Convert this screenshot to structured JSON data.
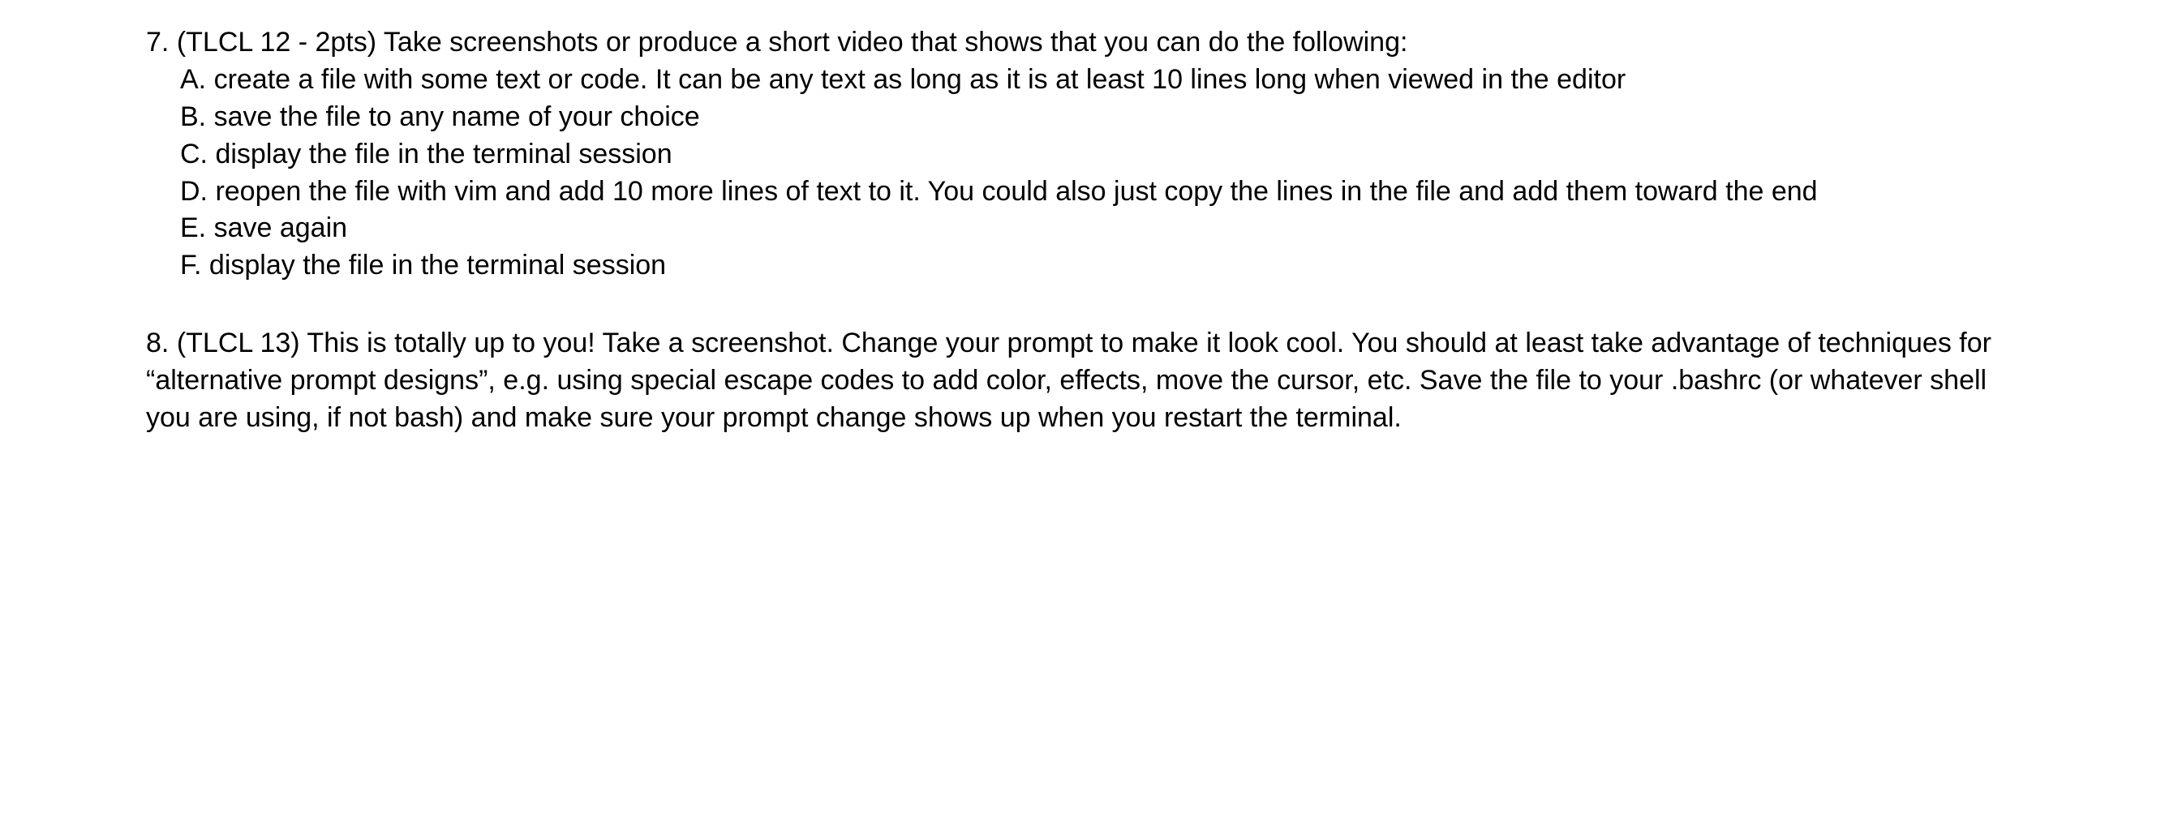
{
  "questions": [
    {
      "number": "7.",
      "intro": "(TLCL 12 - 2pts) Take screenshots or produce a short video that shows that you can do the following:",
      "subitems": [
        {
          "label": "A.",
          "text": "create a file with some text or code. It can be any text as long as it is at least 10 lines long when viewed in the editor"
        },
        {
          "label": "B.",
          "text": "save the file to any name of your choice"
        },
        {
          "label": "C.",
          "text": "display the file in the terminal session"
        },
        {
          "label": "D.",
          "text": "reopen the file with vim and add 10 more lines of text to it. You could also just copy the lines in the file and add them toward the end"
        },
        {
          "label": "E.",
          "text": "save again"
        },
        {
          "label": "F.",
          "text": "display the file in the terminal session"
        }
      ]
    },
    {
      "number": "8.",
      "intro": "(TLCL 13) This is totally up to you! Take a screenshot. Change your prompt to make it look cool. You should at least take advantage of techniques for “alternative prompt designs”, e.g. using special escape codes to add color, effects, move the cursor, etc. Save the file to your .bashrc (or whatever shell you are using, if not bash) and make sure your prompt change shows up when you restart the terminal.",
      "subitems": []
    }
  ]
}
